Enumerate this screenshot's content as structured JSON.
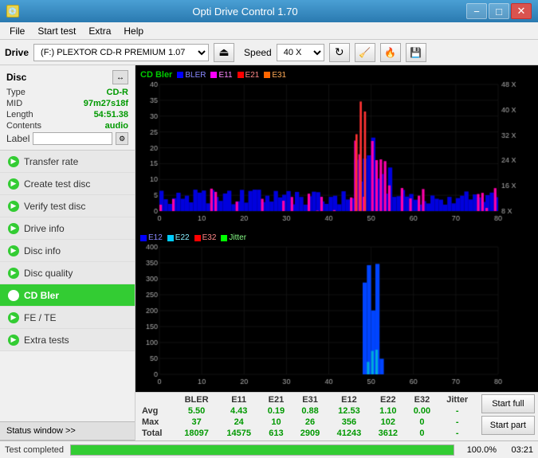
{
  "titlebar": {
    "icon": "💿",
    "title": "Opti Drive Control 1.70",
    "min_label": "−",
    "max_label": "□",
    "close_label": "✕"
  },
  "menubar": {
    "items": [
      "File",
      "Start test",
      "Extra",
      "Help"
    ]
  },
  "drivebar": {
    "label": "Drive",
    "drive_value": "(F:)  PLEXTOR CD-R  PREMIUM 1.07",
    "speed_label": "Speed",
    "speed_value": "40 X"
  },
  "disc": {
    "header": "Disc",
    "type_label": "Type",
    "type_value": "CD-R",
    "mid_label": "MID",
    "mid_value": "97m27s18f",
    "length_label": "Length",
    "length_value": "54:51.38",
    "contents_label": "Contents",
    "contents_value": "audio",
    "label_label": "Label"
  },
  "nav": {
    "items": [
      {
        "id": "transfer-rate",
        "label": "Transfer rate"
      },
      {
        "id": "create-test-disc",
        "label": "Create test disc"
      },
      {
        "id": "verify-test-disc",
        "label": "Verify test disc"
      },
      {
        "id": "drive-info",
        "label": "Drive info"
      },
      {
        "id": "disc-info",
        "label": "Disc info"
      },
      {
        "id": "disc-quality",
        "label": "Disc quality"
      },
      {
        "id": "cd-bler",
        "label": "CD Bler",
        "active": true
      },
      {
        "id": "fe-te",
        "label": "FE / TE"
      },
      {
        "id": "extra-tests",
        "label": "Extra tests"
      }
    ],
    "status_window": "Status window >>"
  },
  "chart1": {
    "title": "CD Bler",
    "legend": [
      {
        "label": "BLER",
        "color": "#0000ff"
      },
      {
        "label": "E11",
        "color": "#ff00ff"
      },
      {
        "label": "E21",
        "color": "#ff0000"
      },
      {
        "label": "E31",
        "color": "#ff6600"
      }
    ],
    "y_max": 40,
    "x_max": 80,
    "y_labels": [
      "40",
      "35",
      "30",
      "25",
      "20",
      "15",
      "10",
      "5"
    ],
    "x_labels": [
      "0",
      "10",
      "20",
      "30",
      "40",
      "50",
      "60",
      "70",
      "80"
    ],
    "right_labels": [
      "48 X",
      "40 X",
      "32 X",
      "24 X",
      "16 X",
      "8 X"
    ]
  },
  "chart2": {
    "legend": [
      {
        "label": "E12",
        "color": "#0000ff"
      },
      {
        "label": "E22",
        "color": "#00ccff"
      },
      {
        "label": "E32",
        "color": "#ff0000"
      },
      {
        "label": "Jitter",
        "color": "#00ff00"
      }
    ],
    "y_max": 400,
    "x_max": 80,
    "y_labels": [
      "400",
      "350",
      "300",
      "250",
      "200",
      "150",
      "100",
      "50"
    ],
    "x_labels": [
      "0",
      "10",
      "20",
      "30",
      "40",
      "50",
      "60",
      "70",
      "80"
    ]
  },
  "datatable": {
    "columns": [
      "",
      "BLER",
      "E11",
      "E21",
      "E31",
      "E12",
      "E22",
      "E32",
      "Jitter"
    ],
    "rows": [
      {
        "label": "Avg",
        "values": [
          "5.50",
          "4.43",
          "0.19",
          "0.88",
          "12.53",
          "1.10",
          "0.00",
          "-"
        ]
      },
      {
        "label": "Max",
        "values": [
          "37",
          "24",
          "10",
          "26",
          "356",
          "102",
          "0",
          "-"
        ]
      },
      {
        "label": "Total",
        "values": [
          "18097",
          "14575",
          "613",
          "2909",
          "41243",
          "3612",
          "0",
          "-"
        ]
      }
    ],
    "start_full": "Start full",
    "start_part": "Start part"
  },
  "statusbar": {
    "text": "Test completed",
    "progress": 100.0,
    "progress_text": "100.0%",
    "time": "03:21"
  },
  "colors": {
    "accent_green": "#33cc33",
    "bg_dark": "#000000",
    "bler": "#0000ff",
    "e11": "#ff00ff",
    "e21": "#ff0000",
    "e31": "#ff6600",
    "e12": "#0000ff",
    "e22": "#00ccff",
    "e32": "#ff0000",
    "jitter": "#00ff00"
  }
}
